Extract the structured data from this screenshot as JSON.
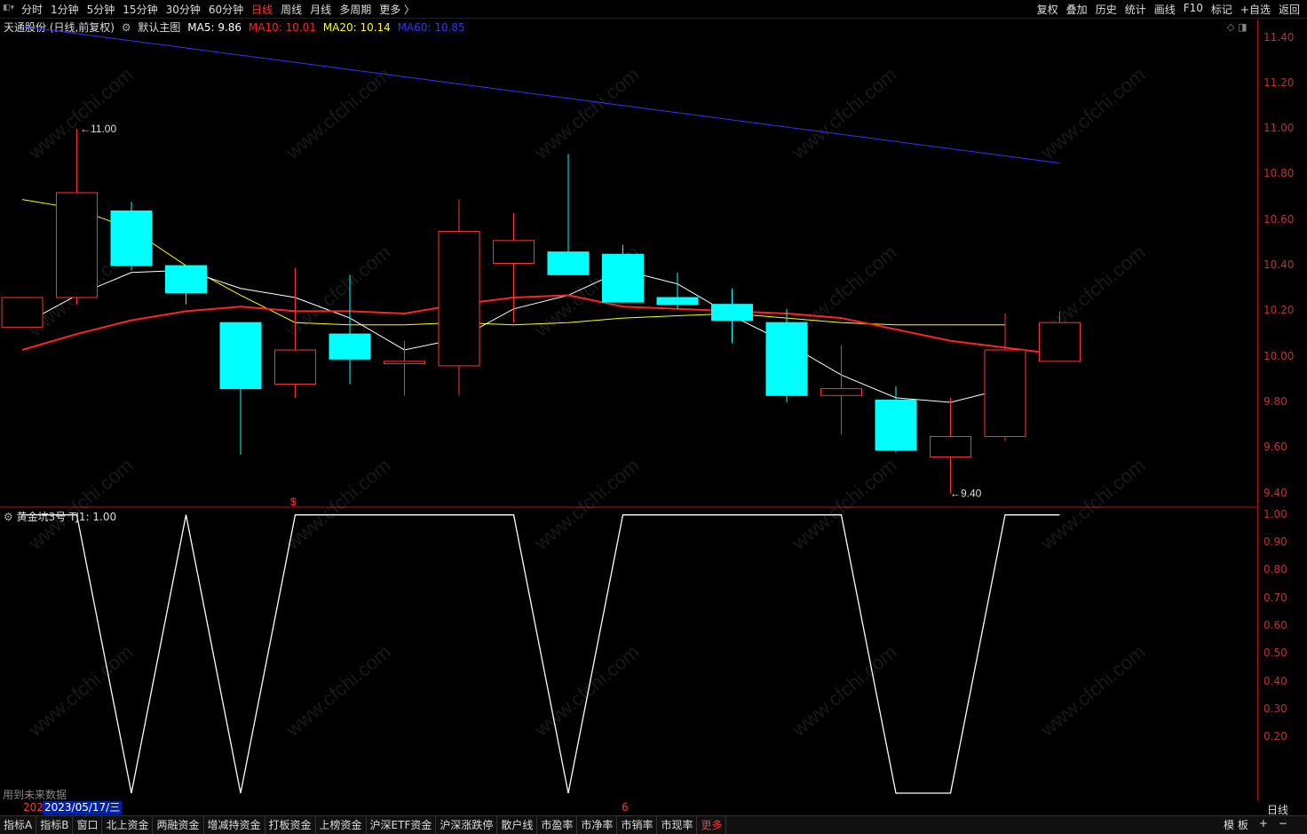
{
  "toolbar": {
    "periods": [
      "分时",
      "1分钟",
      "5分钟",
      "15分钟",
      "30分钟",
      "60分钟",
      "日线",
      "周线",
      "月线",
      "多周期",
      "更多 〉"
    ],
    "active_period": "日线",
    "right_tools": [
      "复权",
      "叠加",
      "历史",
      "统计",
      "画线",
      "F10",
      "标记",
      "+自选",
      "返回"
    ]
  },
  "main_info": {
    "stock": "天通股份 (日线,前复权)",
    "template": "默认主图",
    "ma5": "MA5: 9.86",
    "ma10": "MA10: 10.01",
    "ma20": "MA20: 10.14",
    "ma60": "MA60: 10.85"
  },
  "indicator_info": {
    "name": "黄金坑3号",
    "value": "TJ1: 1.00",
    "future_note": "用到未来数据"
  },
  "annotations": {
    "high": "11.00",
    "low": "9.40",
    "signal": "$"
  },
  "price_axis": [
    "11.40",
    "11.20",
    "11.00",
    "10.80",
    "10.60",
    "10.40",
    "10.20",
    "10.00",
    "9.80",
    "9.60",
    "9.40"
  ],
  "ind_axis": [
    "1.00",
    "0.90",
    "0.80",
    "0.70",
    "0.60",
    "0.50",
    "0.40",
    "0.30",
    "0.20"
  ],
  "date_bar": {
    "left": "202",
    "date": "2023/05/17/三",
    "mid": "6"
  },
  "axis_period_label": "日线",
  "bottom_tabs": [
    "指标A",
    "指标B",
    "窗口",
    "北上资金",
    "两融资金",
    "增减持资金",
    "打板资金",
    "上榜资金",
    "沪深ETF资金",
    "沪深涨跌停",
    "散户线",
    "市盈率",
    "市净率",
    "市销率",
    "市现率",
    "更多"
  ],
  "bottom_right": [
    "模 板",
    "+",
    "−"
  ],
  "watermark": "www.cfchi.com",
  "colors": {
    "up": "#ff3333",
    "down": "#00ffff",
    "ma5": "#ffffff",
    "ma10": "#ff2222",
    "ma20": "#ffff00",
    "ma60": "#3333ff"
  },
  "chart_data": {
    "type": "candlestick",
    "candles": [
      {
        "o": 10.13,
        "c": 10.26,
        "h": 10.26,
        "l": 10.13
      },
      {
        "o": 10.26,
        "c": 10.72,
        "h": 11.0,
        "l": 10.23
      },
      {
        "o": 10.64,
        "c": 10.4,
        "h": 10.68,
        "l": 10.38
      },
      {
        "o": 10.4,
        "c": 10.28,
        "h": 10.4,
        "l": 10.23
      },
      {
        "o": 10.15,
        "c": 9.86,
        "h": 10.15,
        "l": 9.57
      },
      {
        "o": 9.88,
        "c": 10.03,
        "h": 10.39,
        "l": 9.82
      },
      {
        "o": 10.1,
        "c": 9.99,
        "h": 10.36,
        "l": 9.88
      },
      {
        "o": 9.97,
        "c": 9.98,
        "h": 10.07,
        "l": 9.83
      },
      {
        "o": 9.96,
        "c": 10.55,
        "h": 10.69,
        "l": 9.83
      },
      {
        "o": 10.41,
        "c": 10.51,
        "h": 10.63,
        "l": 10.15
      },
      {
        "o": 10.46,
        "c": 10.36,
        "h": 10.89,
        "l": 10.36
      },
      {
        "o": 10.45,
        "c": 10.24,
        "h": 10.49,
        "l": 10.24
      },
      {
        "o": 10.26,
        "c": 10.23,
        "h": 10.37,
        "l": 10.21
      },
      {
        "o": 10.23,
        "c": 10.16,
        "h": 10.3,
        "l": 10.06
      },
      {
        "o": 10.15,
        "c": 9.83,
        "h": 10.21,
        "l": 9.8
      },
      {
        "o": 9.83,
        "c": 9.86,
        "h": 10.05,
        "l": 9.66
      },
      {
        "o": 9.81,
        "c": 9.59,
        "h": 9.87,
        "l": 9.58
      },
      {
        "o": 9.56,
        "c": 9.65,
        "h": 9.82,
        "l": 9.4
      },
      {
        "o": 9.65,
        "c": 10.03,
        "h": 10.19,
        "l": 9.63
      },
      {
        "o": 9.98,
        "c": 10.15,
        "h": 10.2,
        "l": 9.98
      }
    ],
    "ma5": [
      10.14,
      10.27,
      10.37,
      10.38,
      10.3,
      10.26,
      10.17,
      10.03,
      10.08,
      10.21,
      10.27,
      10.38,
      10.32,
      10.18,
      10.06,
      9.92,
      9.82,
      9.8,
      9.86
    ],
    "ma10": [
      10.03,
      10.1,
      10.16,
      10.2,
      10.22,
      10.2,
      10.2,
      10.19,
      10.23,
      10.26,
      10.27,
      10.22,
      10.21,
      10.2,
      10.19,
      10.17,
      10.12,
      10.07,
      10.04,
      10.01
    ],
    "ma20": [
      10.69,
      10.65,
      10.56,
      10.4,
      10.27,
      10.15,
      10.14,
      10.14,
      10.15,
      10.14,
      10.15,
      10.17,
      10.18,
      10.19,
      10.17,
      10.15,
      10.14,
      10.14,
      10.14
    ],
    "ma60": [
      11.45,
      10.85
    ],
    "tj1": [
      1,
      1,
      0,
      1,
      0,
      1,
      1,
      1,
      1,
      1,
      0,
      1,
      1,
      1,
      1,
      1,
      0,
      0,
      1,
      1
    ],
    "price_range": [
      9.34,
      11.48
    ],
    "ind_range": [
      0.0,
      1.05
    ]
  }
}
